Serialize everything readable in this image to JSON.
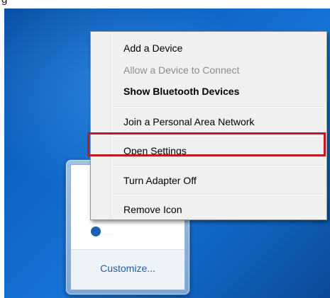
{
  "caption": "g",
  "menu": {
    "items": [
      {
        "label": "Add a Device",
        "enabled": true,
        "bold": false
      },
      {
        "label": "Allow a Device to Connect",
        "enabled": false,
        "bold": false
      },
      {
        "label": "Show Bluetooth Devices",
        "enabled": true,
        "bold": true
      },
      {
        "label": "Join a Personal Area Network",
        "enabled": true,
        "bold": false
      },
      {
        "label": "Open Settings",
        "enabled": true,
        "bold": false,
        "highlighted": true
      },
      {
        "label": "Turn Adapter Off",
        "enabled": true,
        "bold": false
      },
      {
        "label": "Remove Icon",
        "enabled": true,
        "bold": false
      }
    ]
  },
  "tray": {
    "customize_label": "Customize...",
    "partial_text": "…"
  },
  "colors": {
    "highlight_border": "#c01825",
    "desktop": "#1572d6"
  }
}
